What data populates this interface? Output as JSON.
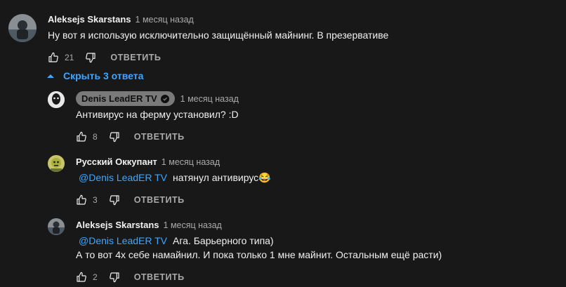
{
  "comments": [
    {
      "author": "Aleksejs Skarstans",
      "time": "1 месяц назад",
      "text": "Ну вот я использую исключительно защищённый майнинг. В презервативе",
      "likes": "21",
      "reply_label": "ОТВЕТИТЬ"
    }
  ],
  "replies_toggle": {
    "label": "Скрыть 3 ответа"
  },
  "replies": [
    {
      "author": "Denis LeadER TV",
      "time": "1 месяц назад",
      "text": "Антивирус на ферму установил? :D",
      "likes": "8",
      "reply_label": "ОТВЕТИТЬ"
    },
    {
      "author": "Русский Оккупант",
      "time": "1 месяц назад",
      "mention": "@Denis LeadER TV",
      "text": "натянул антивирус😂",
      "likes": "3",
      "reply_label": "ОТВЕТИТЬ"
    },
    {
      "author": "Aleksejs Skarstans",
      "time": "1 месяц назад",
      "mention": "@Denis LeadER TV",
      "text": "Ага. Барьерного типа)",
      "text2": "А то вот 4х себе намайнил. И пока только 1 мне майнит. Остальным ещё расти)",
      "likes": "2",
      "reply_label": "ОТВЕТИТЬ"
    }
  ],
  "colors": {
    "background": "#181818",
    "link": "#3ea6ff",
    "secondary": "#aaaaaa"
  }
}
